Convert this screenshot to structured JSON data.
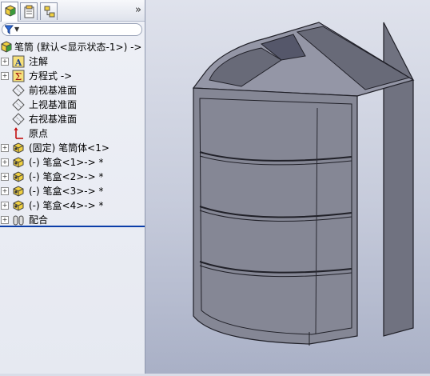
{
  "panel": {
    "tabs": [
      {
        "name": "feature-manager"
      },
      {
        "name": "property-manager"
      },
      {
        "name": "configuration-manager"
      }
    ],
    "more_glyph": "»",
    "filter_dropdown": "▼"
  },
  "tree": {
    "root": "笔筒 (默认<显示状态-1>) ->",
    "items": [
      {
        "label": "注解",
        "icon": "annotation-icon",
        "expandable": true
      },
      {
        "label": "方程式 ->",
        "icon": "equation-icon",
        "expandable": true
      },
      {
        "label": "前视基准面",
        "icon": "plane-icon",
        "expandable": false
      },
      {
        "label": "上视基准面",
        "icon": "plane-icon",
        "expandable": false
      },
      {
        "label": "右视基准面",
        "icon": "plane-icon",
        "expandable": false
      },
      {
        "label": "原点",
        "icon": "origin-icon",
        "expandable": false
      },
      {
        "label": "(固定) 笔筒体<1>",
        "icon": "part-icon",
        "expandable": true
      },
      {
        "label": "(-) 笔盒<1>-> *",
        "icon": "part-icon",
        "expandable": true
      },
      {
        "label": "(-) 笔盒<2>-> *",
        "icon": "part-icon",
        "expandable": true
      },
      {
        "label": "(-) 笔盒<3>-> *",
        "icon": "part-icon",
        "expandable": true
      },
      {
        "label": "(-) 笔盒<4>-> *",
        "icon": "part-icon",
        "expandable": true
      },
      {
        "label": "配合",
        "icon": "mates-icon",
        "expandable": true
      }
    ],
    "expand_glyph": "+"
  },
  "colors": {
    "accent": "#0b3ea8",
    "model_face": "#8d8f9e",
    "model_front": "#80828f",
    "model_edge": "#202028"
  }
}
